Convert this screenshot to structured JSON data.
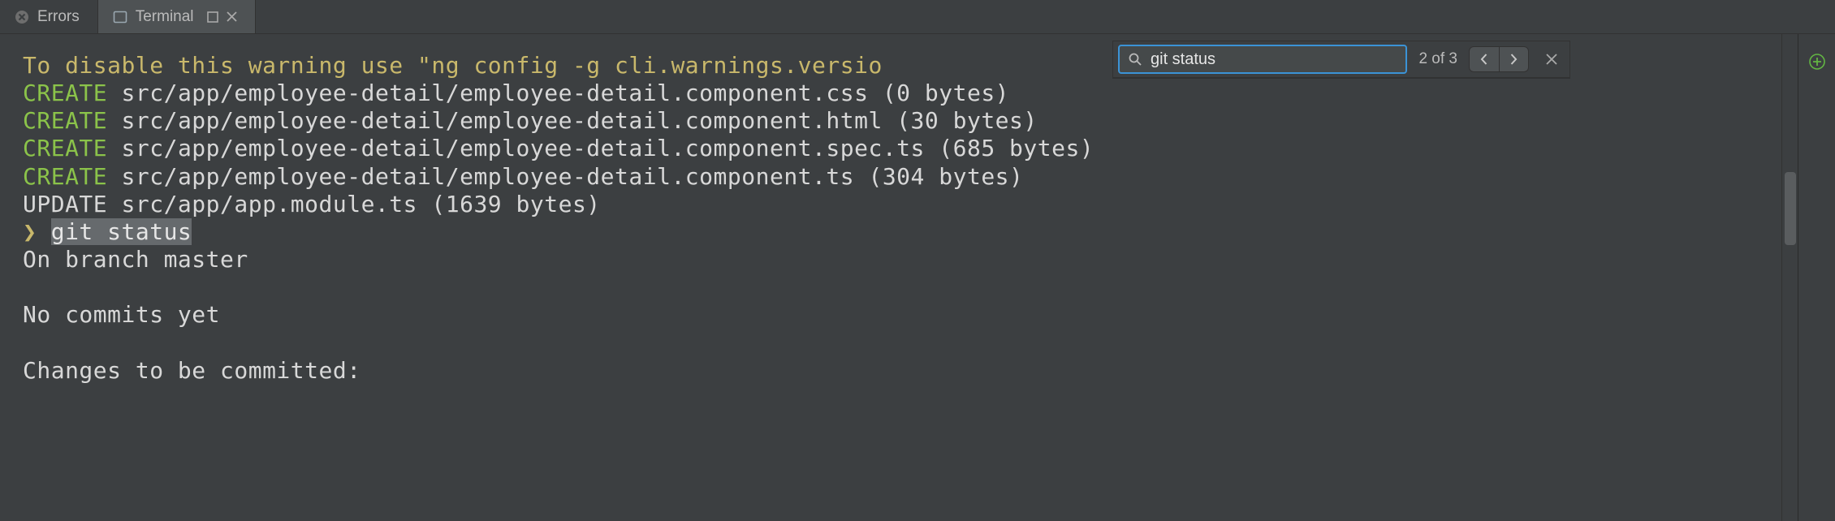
{
  "tabs": {
    "errors": {
      "label": "Errors"
    },
    "terminal": {
      "label": "Terminal"
    }
  },
  "findbar": {
    "query": "git status",
    "placeholder": "",
    "count_text": "2 of 3"
  },
  "terminal": {
    "warn_line": "To disable this warning use \"ng config -g cli.warnings.versio",
    "lines": [
      {
        "prefix": "CREATE",
        "rest": " src/app/employee-detail/employee-detail.component.css (0 bytes)"
      },
      {
        "prefix": "CREATE",
        "rest": " src/app/employee-detail/employee-detail.component.html (30 bytes)"
      },
      {
        "prefix": "CREATE",
        "rest": " src/app/employee-detail/employee-detail.component.spec.ts (685 bytes)"
      },
      {
        "prefix": "CREATE",
        "rest": " src/app/employee-detail/employee-detail.component.ts (304 bytes)"
      }
    ],
    "update_line": "UPDATE src/app/app.module.ts (1639 bytes)",
    "prompt": {
      "symbol": "❯",
      "command": "git status"
    },
    "after": [
      "On branch master",
      "",
      "No commits yet",
      "",
      "Changes to be committed:"
    ]
  }
}
